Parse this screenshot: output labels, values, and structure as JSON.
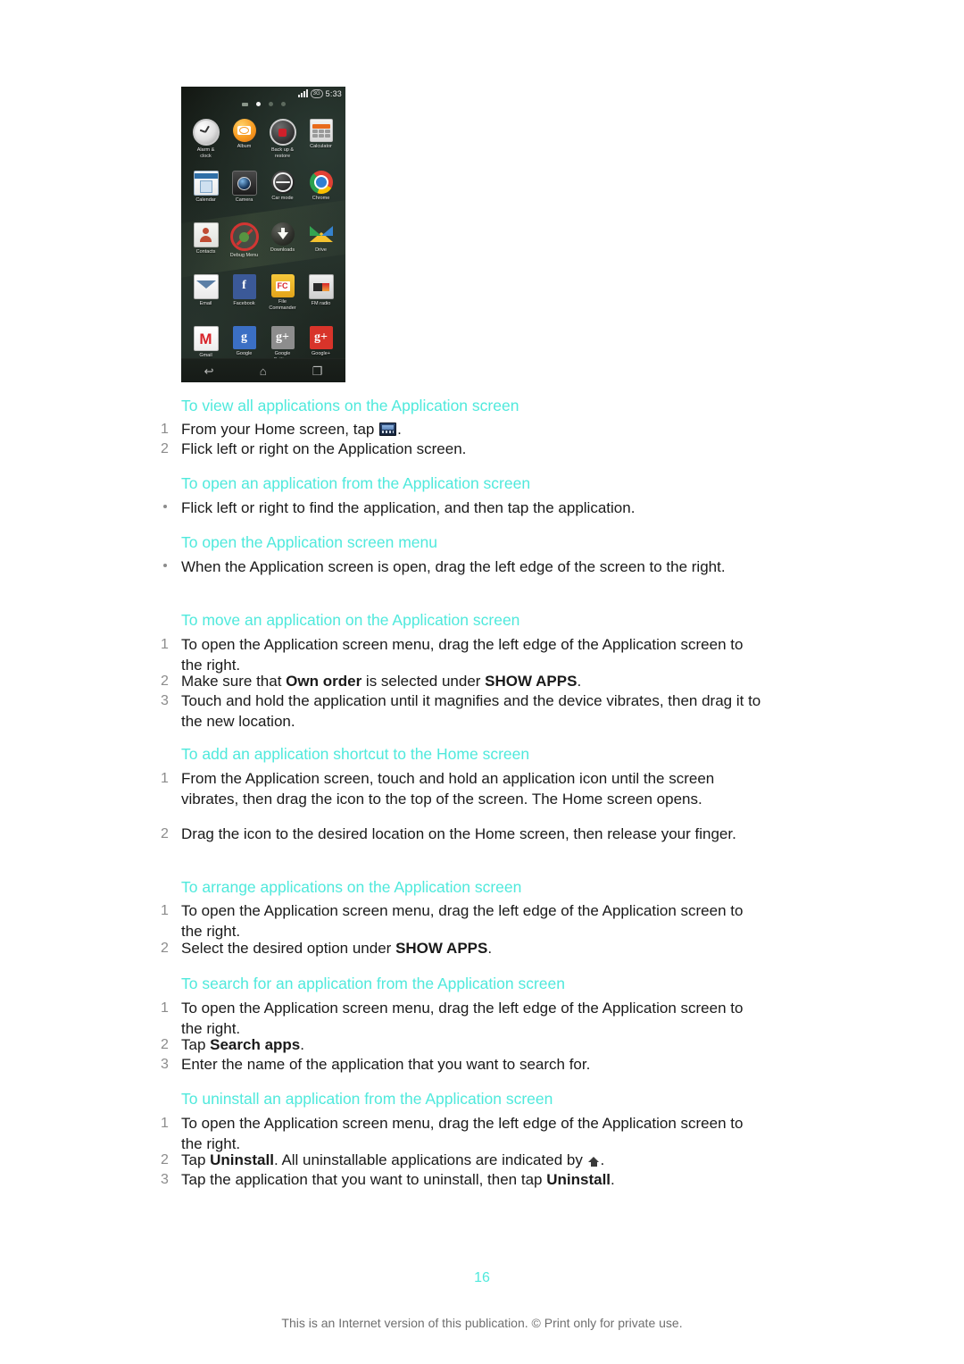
{
  "colors": {
    "heading": "#4FE9DC",
    "body": "#1a1a1a",
    "number": "#8c8c8c",
    "footer": "#6f6f6f"
  },
  "screenshot": {
    "status_bar": {
      "network_label": "3G",
      "time": "5:33"
    },
    "page_indicator": {
      "count": 4,
      "active_index": 1
    },
    "apps": [
      {
        "label": "Alarm &\nclock",
        "icon": "alarm-clock-icon"
      },
      {
        "label": "Album",
        "icon": "album-icon"
      },
      {
        "label": "Back up &\nrestore",
        "icon": "backup-restore-icon"
      },
      {
        "label": "Calculator",
        "icon": "calculator-icon"
      },
      {
        "label": "Calendar",
        "icon": "calendar-icon"
      },
      {
        "label": "Camera",
        "icon": "camera-icon"
      },
      {
        "label": "Car mode",
        "icon": "car-mode-icon"
      },
      {
        "label": "Chrome",
        "icon": "chrome-icon"
      },
      {
        "label": "Contacts",
        "icon": "contacts-icon"
      },
      {
        "label": "Debug Menu",
        "icon": "debug-menu-icon"
      },
      {
        "label": "Downloads",
        "icon": "downloads-icon"
      },
      {
        "label": "Drive",
        "icon": "drive-icon"
      },
      {
        "label": "Email",
        "icon": "email-icon"
      },
      {
        "label": "Facebook",
        "icon": "facebook-icon"
      },
      {
        "label": "File\nCommander",
        "icon": "file-commander-icon"
      },
      {
        "label": "FM radio",
        "icon": "fm-radio-icon"
      },
      {
        "label": "Gmail",
        "icon": "gmail-icon"
      },
      {
        "label": "Google",
        "icon": "google-icon"
      },
      {
        "label": "Google\nSettings",
        "icon": "google-settings-icon"
      },
      {
        "label": "Google+",
        "icon": "google-plus-icon"
      }
    ],
    "nav_bar": {
      "back": "↩",
      "home": "⌂",
      "recents": "❐"
    }
  },
  "sections": [
    {
      "heading": "To view all applications on the Application screen",
      "steps": [
        {
          "marker": "1",
          "text_before": "From your Home screen, tap ",
          "icon": "app-drawer-icon",
          "text_after": "."
        },
        {
          "marker": "2",
          "text": "Flick left or right on the Application screen."
        }
      ]
    },
    {
      "heading": "To open an application from the Application screen",
      "steps": [
        {
          "marker": "bullet",
          "text": "Flick left or right to find the application, and then tap the application."
        }
      ]
    },
    {
      "heading": "To open the Application screen menu",
      "steps": [
        {
          "marker": "bullet",
          "text": "When the Application screen is open, drag the left edge of the screen to the right."
        }
      ]
    },
    {
      "heading": "To move an application on the Application screen",
      "steps": [
        {
          "marker": "1",
          "text": "To open the Application screen menu, drag the left edge of the Application screen to the right."
        },
        {
          "marker": "2",
          "text_before": "Make sure that ",
          "bold1": "Own order",
          "text_mid": " is selected under ",
          "bold2": "SHOW APPS",
          "text_after": "."
        },
        {
          "marker": "3",
          "text": "Touch and hold the application until it magnifies and the device vibrates, then drag it to the new location."
        }
      ]
    },
    {
      "heading": "To add an application shortcut to the Home screen",
      "steps": [
        {
          "marker": "1",
          "text": "From the Application screen, touch and hold an application icon until the screen vibrates, then drag the icon to the top of the screen. The Home screen opens."
        },
        {
          "marker": "2",
          "text": "Drag the icon to the desired location on the Home screen, then release your finger."
        }
      ]
    },
    {
      "heading": "To arrange applications on the Application screen",
      "steps": [
        {
          "marker": "1",
          "text": "To open the Application screen menu, drag the left edge of the Application screen to the right."
        },
        {
          "marker": "2",
          "text_before": "Select the desired option under ",
          "bold1": "SHOW APPS",
          "text_after": "."
        }
      ]
    },
    {
      "heading": "To search for an application from the Application screen",
      "steps": [
        {
          "marker": "1",
          "text": "To open the Application screen menu, drag the left edge of the Application screen to the right."
        },
        {
          "marker": "2",
          "text_before": "Tap ",
          "bold1": "Search apps",
          "text_after": "."
        },
        {
          "marker": "3",
          "text": "Enter the name of the application that you want to search for."
        }
      ]
    },
    {
      "heading": "To uninstall an application from the Application screen",
      "steps": [
        {
          "marker": "1",
          "text": "To open the Application screen menu, drag the left edge of the Application screen to the right."
        },
        {
          "marker": "2",
          "text_before": "Tap ",
          "bold1": "Uninstall",
          "text_mid": ". All uninstallable applications are indicated by ",
          "icon": "uninstall-home-icon",
          "text_after": "."
        },
        {
          "marker": "3",
          "text_before": "Tap the application that you want to uninstall, then tap ",
          "bold1": "Uninstall",
          "text_after": "."
        }
      ]
    }
  ],
  "page_number": "16",
  "footer": "This is an Internet version of this publication. © Print only for private use."
}
